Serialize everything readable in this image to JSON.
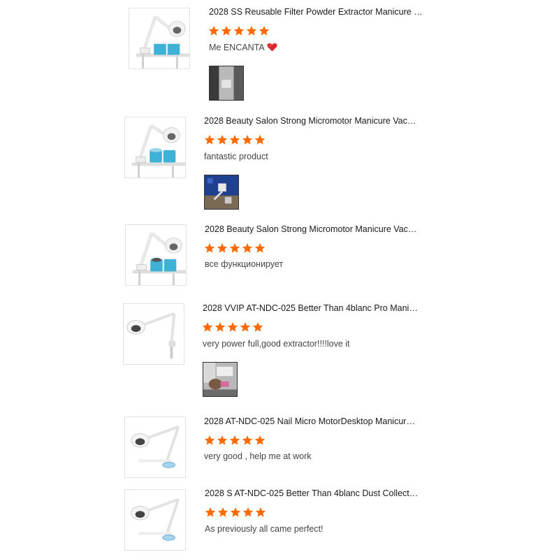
{
  "colors": {
    "star": "#ff6a00",
    "heart": "#e0242c"
  },
  "reviews": [
    {
      "product_title": "2028 SS Reusable Filter Powder Extractor Manicure P...",
      "rating": 5,
      "comment": "Me ENCANTA",
      "comment_icon": "heart-icon",
      "has_photo": true
    },
    {
      "product_title": "2028 Beauty Salon Strong Micromotor Manicure Vacu...",
      "rating": 5,
      "comment": "fantastic product",
      "has_photo": true
    },
    {
      "product_title": "2028 Beauty Salon Strong Micromotor Manicure Vacu...",
      "rating": 5,
      "comment": "все функционирует",
      "has_photo": false
    },
    {
      "product_title": "2028 VVIP AT-NDC-025 Better Than 4blanc Pro Manic...",
      "rating": 5,
      "comment": "very power full,good extractor!!!!love it",
      "has_photo": true
    },
    {
      "product_title": "2028 AT-NDC-025 Nail Micro MotorDesktop Manicure ...",
      "rating": 5,
      "comment": "very good , help me at work",
      "has_photo": false
    },
    {
      "product_title": "2028 S AT-NDC-025 Better Than 4blanc Dust Collecto...",
      "rating": 5,
      "comment": "As previously all came perfect!",
      "has_photo": false
    }
  ]
}
